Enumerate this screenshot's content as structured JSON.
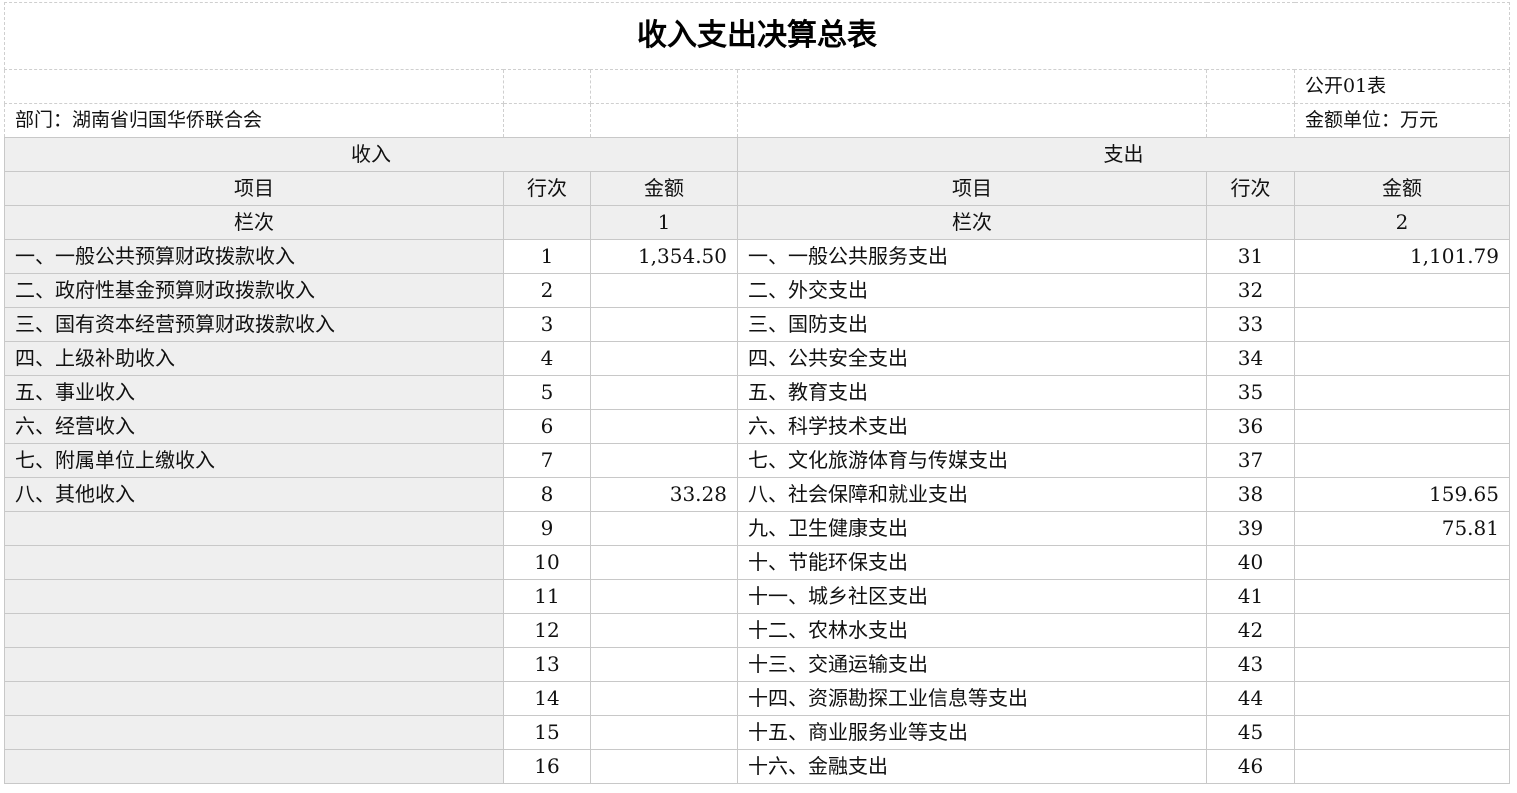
{
  "title": "收入支出决算总表",
  "table_code": "公开01表",
  "department": "部门：湖南省归国华侨联合会",
  "unit": "金额单位：万元",
  "section_income": "收入",
  "section_expense": "支出",
  "col_item": "项目",
  "col_line": "行次",
  "col_amount": "金额",
  "col_index_label": "栏次",
  "income_col_index": "1",
  "expense_col_index": "2",
  "rows": [
    {
      "income_item": "一、一般公共预算财政拨款收入",
      "income_line": "1",
      "income_amount": "1,354.50",
      "expense_item": "一、一般公共服务支出",
      "expense_line": "31",
      "expense_amount": "1,101.79"
    },
    {
      "income_item": "二、政府性基金预算财政拨款收入",
      "income_line": "2",
      "income_amount": "",
      "expense_item": "二、外交支出",
      "expense_line": "32",
      "expense_amount": ""
    },
    {
      "income_item": "三、国有资本经营预算财政拨款收入",
      "income_line": "3",
      "income_amount": "",
      "expense_item": "三、国防支出",
      "expense_line": "33",
      "expense_amount": ""
    },
    {
      "income_item": "四、上级补助收入",
      "income_line": "4",
      "income_amount": "",
      "expense_item": "四、公共安全支出",
      "expense_line": "34",
      "expense_amount": ""
    },
    {
      "income_item": "五、事业收入",
      "income_line": "5",
      "income_amount": "",
      "expense_item": "五、教育支出",
      "expense_line": "35",
      "expense_amount": ""
    },
    {
      "income_item": "六、经营收入",
      "income_line": "6",
      "income_amount": "",
      "expense_item": "六、科学技术支出",
      "expense_line": "36",
      "expense_amount": ""
    },
    {
      "income_item": "七、附属单位上缴收入",
      "income_line": "7",
      "income_amount": "",
      "expense_item": "七、文化旅游体育与传媒支出",
      "expense_line": "37",
      "expense_amount": ""
    },
    {
      "income_item": "八、其他收入",
      "income_line": "8",
      "income_amount": "33.28",
      "expense_item": "八、社会保障和就业支出",
      "expense_line": "38",
      "expense_amount": "159.65"
    },
    {
      "income_item": "",
      "income_line": "9",
      "income_amount": "",
      "expense_item": "九、卫生健康支出",
      "expense_line": "39",
      "expense_amount": "75.81"
    },
    {
      "income_item": "",
      "income_line": "10",
      "income_amount": "",
      "expense_item": "十、节能环保支出",
      "expense_line": "40",
      "expense_amount": ""
    },
    {
      "income_item": "",
      "income_line": "11",
      "income_amount": "",
      "expense_item": "十一、城乡社区支出",
      "expense_line": "41",
      "expense_amount": ""
    },
    {
      "income_item": "",
      "income_line": "12",
      "income_amount": "",
      "expense_item": "十二、农林水支出",
      "expense_line": "42",
      "expense_amount": ""
    },
    {
      "income_item": "",
      "income_line": "13",
      "income_amount": "",
      "expense_item": "十三、交通运输支出",
      "expense_line": "43",
      "expense_amount": ""
    },
    {
      "income_item": "",
      "income_line": "14",
      "income_amount": "",
      "expense_item": "十四、资源勘探工业信息等支出",
      "expense_line": "44",
      "expense_amount": ""
    },
    {
      "income_item": "",
      "income_line": "15",
      "income_amount": "",
      "expense_item": "十五、商业服务业等支出",
      "expense_line": "45",
      "expense_amount": ""
    },
    {
      "income_item": "",
      "income_line": "16",
      "income_amount": "",
      "expense_item": "十六、金融支出",
      "expense_line": "46",
      "expense_amount": ""
    }
  ]
}
